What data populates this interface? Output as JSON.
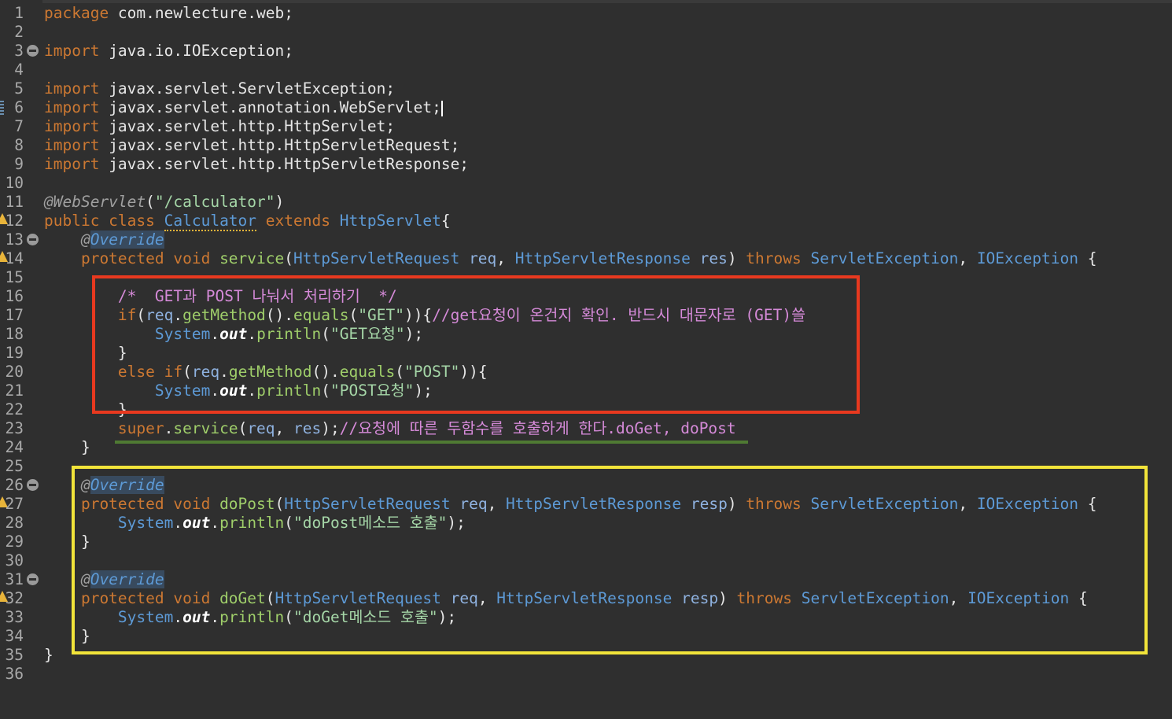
{
  "editor": {
    "lines": [
      {
        "n": "1",
        "tokens": [
          {
            "t": "package ",
            "c": "kw"
          },
          {
            "t": "com.newlecture.web;",
            "c": ""
          }
        ]
      },
      {
        "n": "2",
        "tokens": []
      },
      {
        "n": "3",
        "fold": true,
        "tokens": [
          {
            "t": "import ",
            "c": "kw"
          },
          {
            "t": "java.io.IOException;",
            "c": ""
          }
        ]
      },
      {
        "n": "4",
        "tokens": []
      },
      {
        "n": "5",
        "tokens": [
          {
            "t": "import ",
            "c": "kw"
          },
          {
            "t": "javax.servlet.ServletException;",
            "c": ""
          }
        ]
      },
      {
        "n": "6",
        "mark": true,
        "cursor": true,
        "tokens": [
          {
            "t": "import ",
            "c": "kw"
          },
          {
            "t": "javax.servlet.annotation.WebServlet;",
            "c": ""
          }
        ]
      },
      {
        "n": "7",
        "tokens": [
          {
            "t": "import ",
            "c": "kw"
          },
          {
            "t": "javax.servlet.http.HttpServlet;",
            "c": ""
          }
        ]
      },
      {
        "n": "8",
        "tokens": [
          {
            "t": "import ",
            "c": "kw"
          },
          {
            "t": "javax.servlet.http.HttpServletRequest;",
            "c": ""
          }
        ]
      },
      {
        "n": "9",
        "tokens": [
          {
            "t": "import ",
            "c": "kw"
          },
          {
            "t": "javax.servlet.http.HttpServletResponse;",
            "c": ""
          }
        ]
      },
      {
        "n": "10",
        "tokens": []
      },
      {
        "n": "11",
        "tokens": [
          {
            "t": "@WebServlet",
            "c": "ann"
          },
          {
            "t": "(",
            "c": ""
          },
          {
            "t": "\"/calculator\"",
            "c": "str"
          },
          {
            "t": ")",
            "c": ""
          }
        ]
      },
      {
        "n": "12",
        "warn": true,
        "tokens": [
          {
            "t": "public class ",
            "c": "kw"
          },
          {
            "t": "Calculator",
            "c": "cls-u"
          },
          {
            "t": " extends ",
            "c": "kw"
          },
          {
            "t": "HttpServlet",
            "c": "ty"
          },
          {
            "t": "{",
            "c": ""
          }
        ]
      },
      {
        "n": "13",
        "fold": true,
        "tokens": [
          {
            "t": "    ",
            "c": ""
          },
          {
            "t": "@",
            "c": "ann"
          },
          {
            "t": "Override",
            "c": "ovr"
          }
        ]
      },
      {
        "n": "14",
        "warn": true,
        "tokens": [
          {
            "t": "    protected void ",
            "c": "kw"
          },
          {
            "t": "service",
            "c": "mth"
          },
          {
            "t": "(",
            "c": ""
          },
          {
            "t": "HttpServletRequest",
            "c": "ty"
          },
          {
            "t": " req",
            "c": "var"
          },
          {
            "t": ", ",
            "c": ""
          },
          {
            "t": "HttpServletResponse",
            "c": "ty"
          },
          {
            "t": " res",
            "c": "var"
          },
          {
            "t": ") ",
            "c": ""
          },
          {
            "t": "throws ",
            "c": "kw"
          },
          {
            "t": "ServletException",
            "c": "ty"
          },
          {
            "t": ", ",
            "c": ""
          },
          {
            "t": "IOException",
            "c": "ty"
          },
          {
            "t": " {",
            "c": ""
          }
        ]
      },
      {
        "n": "15",
        "tokens": []
      },
      {
        "n": "16",
        "tokens": [
          {
            "t": "        ",
            "c": ""
          },
          {
            "t": "/*  GET과 POST 나눠서 처리하기  */",
            "c": "cm"
          }
        ]
      },
      {
        "n": "17",
        "tokens": [
          {
            "t": "        ",
            "c": ""
          },
          {
            "t": "if",
            "c": "kw"
          },
          {
            "t": "(",
            "c": ""
          },
          {
            "t": "req",
            "c": "var"
          },
          {
            "t": ".",
            "c": ""
          },
          {
            "t": "getMethod",
            "c": "mth"
          },
          {
            "t": "().",
            "c": ""
          },
          {
            "t": "equals",
            "c": "mth"
          },
          {
            "t": "(",
            "c": ""
          },
          {
            "t": "\"GET\"",
            "c": "str"
          },
          {
            "t": ")){",
            "c": ""
          },
          {
            "t": "//get요청이 온건지 확인. 반드시 대문자로 (GET)쓸",
            "c": "cm"
          }
        ]
      },
      {
        "n": "18",
        "tokens": [
          {
            "t": "            ",
            "c": ""
          },
          {
            "t": "System",
            "c": "ty"
          },
          {
            "t": ".",
            "c": ""
          },
          {
            "t": "out",
            "c": "fld"
          },
          {
            "t": ".",
            "c": ""
          },
          {
            "t": "println",
            "c": "mth"
          },
          {
            "t": "(",
            "c": ""
          },
          {
            "t": "\"GET요청\"",
            "c": "str"
          },
          {
            "t": ");",
            "c": ""
          }
        ]
      },
      {
        "n": "19",
        "tokens": [
          {
            "t": "        }",
            "c": ""
          }
        ]
      },
      {
        "n": "20",
        "tokens": [
          {
            "t": "        ",
            "c": ""
          },
          {
            "t": "else if",
            "c": "kw"
          },
          {
            "t": "(",
            "c": ""
          },
          {
            "t": "req",
            "c": "var"
          },
          {
            "t": ".",
            "c": ""
          },
          {
            "t": "getMethod",
            "c": "mth"
          },
          {
            "t": "().",
            "c": ""
          },
          {
            "t": "equals",
            "c": "mth"
          },
          {
            "t": "(",
            "c": ""
          },
          {
            "t": "\"POST\"",
            "c": "str"
          },
          {
            "t": ")){",
            "c": ""
          }
        ]
      },
      {
        "n": "21",
        "tokens": [
          {
            "t": "            ",
            "c": ""
          },
          {
            "t": "System",
            "c": "ty"
          },
          {
            "t": ".",
            "c": ""
          },
          {
            "t": "out",
            "c": "fld"
          },
          {
            "t": ".",
            "c": ""
          },
          {
            "t": "println",
            "c": "mth"
          },
          {
            "t": "(",
            "c": ""
          },
          {
            "t": "\"POST요청\"",
            "c": "str"
          },
          {
            "t": ");",
            "c": ""
          }
        ]
      },
      {
        "n": "22",
        "tokens": [
          {
            "t": "        }",
            "c": ""
          }
        ]
      },
      {
        "n": "23",
        "tokens": [
          {
            "t": "        ",
            "c": ""
          },
          {
            "t": "super",
            "c": "kw"
          },
          {
            "t": ".",
            "c": ""
          },
          {
            "t": "service",
            "c": "mth"
          },
          {
            "t": "(",
            "c": ""
          },
          {
            "t": "req",
            "c": "var"
          },
          {
            "t": ", ",
            "c": ""
          },
          {
            "t": "res",
            "c": "var"
          },
          {
            "t": ");",
            "c": ""
          },
          {
            "t": "//요청에 따른 두함수를 호출하게 한다.doGet, doPost",
            "c": "cm"
          }
        ]
      },
      {
        "n": "24",
        "tokens": [
          {
            "t": "    }",
            "c": ""
          }
        ]
      },
      {
        "n": "25",
        "tokens": []
      },
      {
        "n": "26",
        "fold": true,
        "tokens": [
          {
            "t": "    ",
            "c": ""
          },
          {
            "t": "@",
            "c": "ann"
          },
          {
            "t": "Override",
            "c": "ovr"
          }
        ]
      },
      {
        "n": "27",
        "warn": true,
        "tokens": [
          {
            "t": "    protected void ",
            "c": "kw"
          },
          {
            "t": "doPost",
            "c": "mth"
          },
          {
            "t": "(",
            "c": ""
          },
          {
            "t": "HttpServletRequest",
            "c": "ty"
          },
          {
            "t": " req",
            "c": "var"
          },
          {
            "t": ", ",
            "c": ""
          },
          {
            "t": "HttpServletResponse",
            "c": "ty"
          },
          {
            "t": " resp",
            "c": "var"
          },
          {
            "t": ") ",
            "c": ""
          },
          {
            "t": "throws ",
            "c": "kw"
          },
          {
            "t": "ServletException",
            "c": "ty"
          },
          {
            "t": ", ",
            "c": ""
          },
          {
            "t": "IOException",
            "c": "ty"
          },
          {
            "t": " {",
            "c": ""
          }
        ]
      },
      {
        "n": "28",
        "tokens": [
          {
            "t": "        ",
            "c": ""
          },
          {
            "t": "System",
            "c": "ty"
          },
          {
            "t": ".",
            "c": ""
          },
          {
            "t": "out",
            "c": "fld"
          },
          {
            "t": ".",
            "c": ""
          },
          {
            "t": "println",
            "c": "mth"
          },
          {
            "t": "(",
            "c": ""
          },
          {
            "t": "\"doPost메소드 호출\"",
            "c": "str"
          },
          {
            "t": ");",
            "c": ""
          }
        ]
      },
      {
        "n": "29",
        "tokens": [
          {
            "t": "    }",
            "c": ""
          }
        ]
      },
      {
        "n": "30",
        "tokens": []
      },
      {
        "n": "31",
        "fold": true,
        "tokens": [
          {
            "t": "    ",
            "c": ""
          },
          {
            "t": "@",
            "c": "ann"
          },
          {
            "t": "Override",
            "c": "ovr"
          }
        ]
      },
      {
        "n": "32",
        "warn": true,
        "tokens": [
          {
            "t": "    protected void ",
            "c": "kw"
          },
          {
            "t": "doGet",
            "c": "mth"
          },
          {
            "t": "(",
            "c": ""
          },
          {
            "t": "HttpServletRequest",
            "c": "ty"
          },
          {
            "t": " req",
            "c": "var"
          },
          {
            "t": ", ",
            "c": ""
          },
          {
            "t": "HttpServletResponse",
            "c": "ty"
          },
          {
            "t": " resp",
            "c": "var"
          },
          {
            "t": ") ",
            "c": ""
          },
          {
            "t": "throws ",
            "c": "kw"
          },
          {
            "t": "ServletException",
            "c": "ty"
          },
          {
            "t": ", ",
            "c": ""
          },
          {
            "t": "IOException",
            "c": "ty"
          },
          {
            "t": " {",
            "c": ""
          }
        ]
      },
      {
        "n": "33",
        "tokens": [
          {
            "t": "        ",
            "c": ""
          },
          {
            "t": "System",
            "c": "ty"
          },
          {
            "t": ".",
            "c": ""
          },
          {
            "t": "out",
            "c": "fld"
          },
          {
            "t": ".",
            "c": ""
          },
          {
            "t": "println",
            "c": "mth"
          },
          {
            "t": "(",
            "c": ""
          },
          {
            "t": "\"doGet메소드 호출\"",
            "c": "str"
          },
          {
            "t": ");",
            "c": ""
          }
        ]
      },
      {
        "n": "34",
        "tokens": [
          {
            "t": "    }",
            "c": ""
          }
        ]
      },
      {
        "n": "35",
        "tokens": [
          {
            "t": "}",
            "c": ""
          }
        ]
      },
      {
        "n": "36",
        "tokens": []
      }
    ]
  },
  "icons": {
    "fold": "fold-collapse-icon",
    "warning": "warning-icon",
    "change_marker": "change-marker-icon"
  },
  "colors": {
    "background": "#2f2f2f",
    "keyword": "#cc7832",
    "type": "#5d9ad6",
    "string": "#a5d6a7",
    "comment": "#d58ad8",
    "highlight_red": "#e8391f",
    "highlight_yellow": "#f2e43a",
    "underline_green": "#4f7a33"
  }
}
